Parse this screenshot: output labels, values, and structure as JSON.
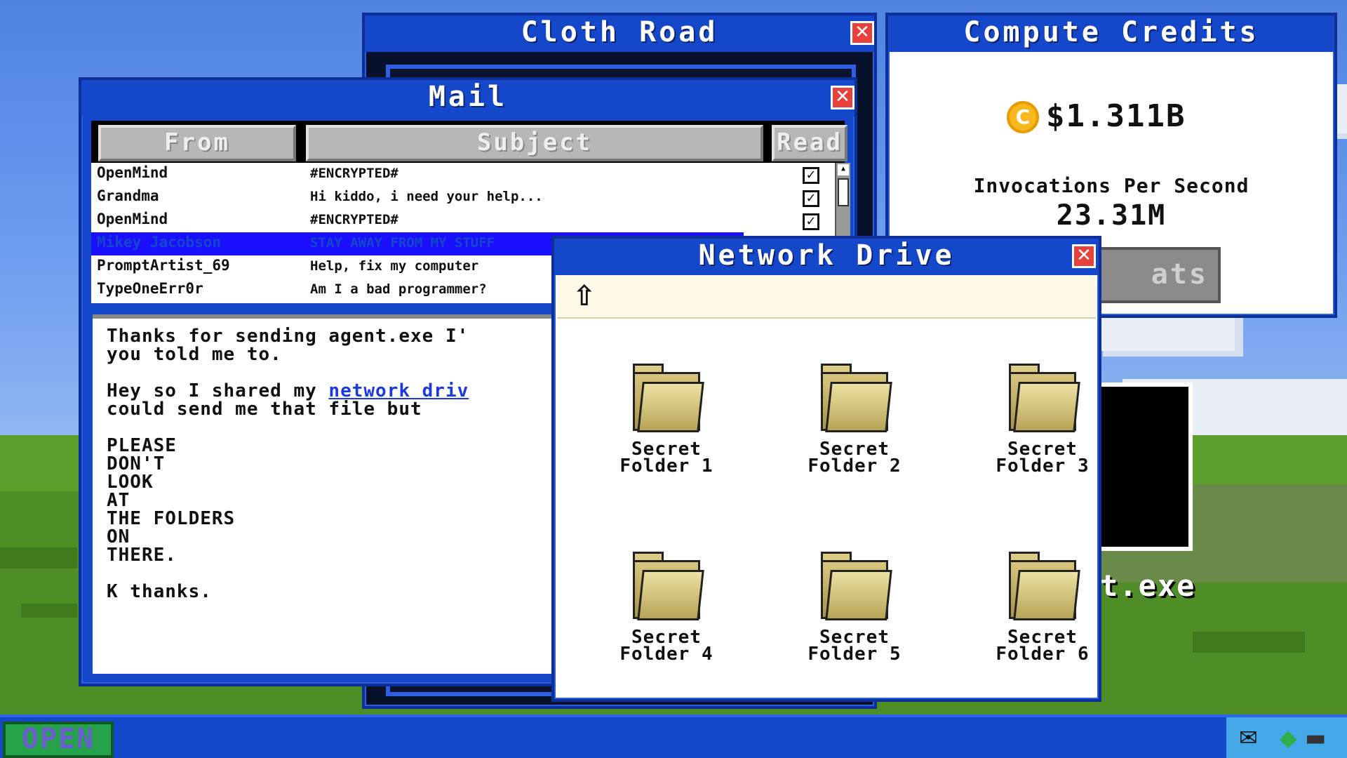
{
  "desktop": {
    "exe_label": "t.exe"
  },
  "cloth_road": {
    "title": "Cloth Road",
    "close": "✕"
  },
  "credits": {
    "title": "Compute Credits",
    "close": "✕",
    "coin_symbol": "C",
    "amount": "$1.311B",
    "ips_label": "Invocations Per Second",
    "ips_value": "23.31M",
    "stats_button": "ats"
  },
  "mail": {
    "title": "Mail",
    "close": "✕",
    "columns": {
      "from": "From",
      "subject": "Subject",
      "read": "Read"
    },
    "messages": [
      {
        "from": "OpenMind",
        "subject": "#ENCRYPTED#",
        "read": "✓"
      },
      {
        "from": "Grandma",
        "subject": "Hi kiddo, i need your help...",
        "read": "✓"
      },
      {
        "from": "OpenMind",
        "subject": "#ENCRYPTED#",
        "read": "✓"
      },
      {
        "from": "Mikey Jacobson",
        "subject": "STAY AWAY FROM MY STUFF",
        "read": ""
      },
      {
        "from": "PromptArtist_69",
        "subject": "Help, fix my computer",
        "read": ""
      },
      {
        "from": "TypeOneErr0r",
        "subject": "Am I a bad programmer?",
        "read": ""
      }
    ],
    "body": {
      "line1": "Thanks for sending agent.exe I'",
      "line2": "you told me to.",
      "line3a": "Hey so I shared my ",
      "line3_link": "network driv",
      "line4": "could send me that file but",
      "line5": "PLEASE",
      "line6": "DON'T",
      "line7": "LOOK",
      "line8": "AT",
      "line9": "THE FOLDERS",
      "line10": "ON",
      "line11": "THERE.",
      "line12": "K thanks."
    }
  },
  "network_drive": {
    "title": "Network Drive",
    "close": "✕",
    "up_icon": "⇧",
    "folders": [
      {
        "line1": "Secret",
        "line2": "Folder 1"
      },
      {
        "line1": "Secret",
        "line2": "Folder 2"
      },
      {
        "line1": "Secret",
        "line2": "Folder 3"
      },
      {
        "line1": "Secret",
        "line2": "Folder 4"
      },
      {
        "line1": "Secret",
        "line2": "Folder 5"
      },
      {
        "line1": "Secret",
        "line2": "Folder 6"
      }
    ]
  },
  "taskbar": {
    "open_label": "OPEN",
    "tray": {
      "mail_icon": "✉",
      "status_icon": "◆",
      "drive_icon": "▬"
    }
  }
}
